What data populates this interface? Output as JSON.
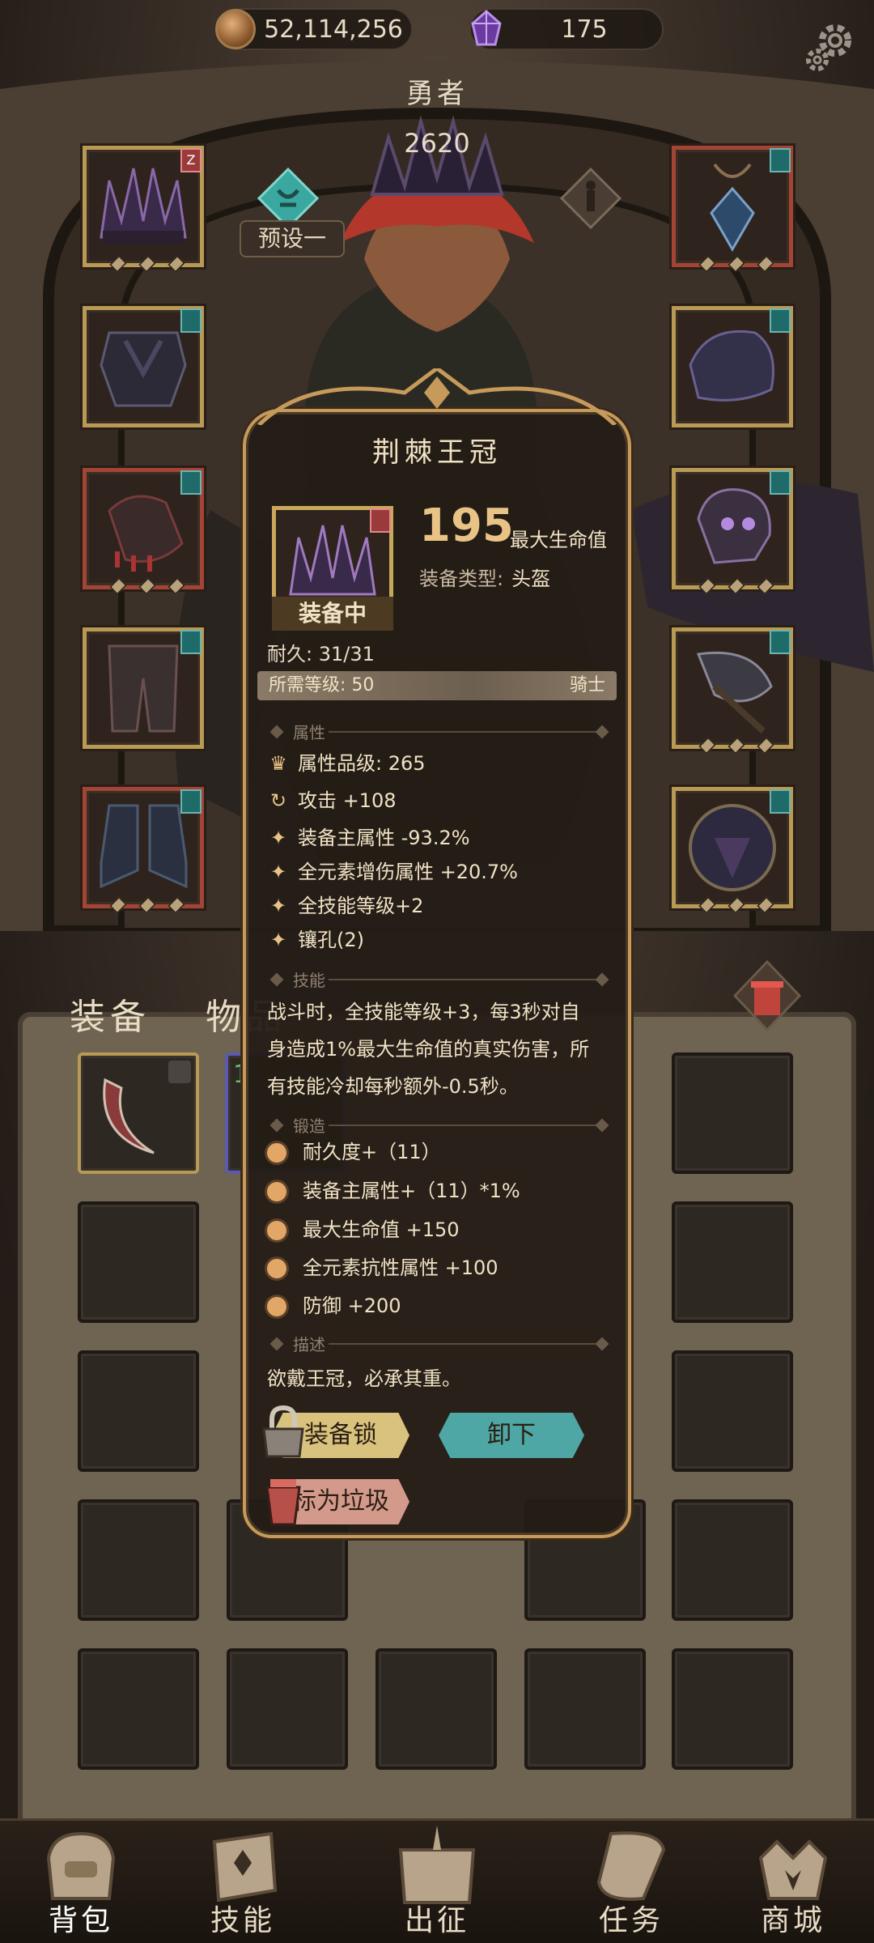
{
  "top": {
    "gold": "52,114,256",
    "gems": "175",
    "gold_icon": "gold-coin-icon",
    "gem_icon": "purple-crystal-icon",
    "settings_icon": "gear-icon"
  },
  "hero": {
    "name": "勇者",
    "power": "2620",
    "preset_label": "预设一"
  },
  "slot_badges": {
    "helmet": "Z"
  },
  "tabs": {
    "equipment": "装备",
    "items": "物品"
  },
  "inventory": {
    "first_item_badge": "1"
  },
  "nav": {
    "items": [
      {
        "label": "背包",
        "icon": "bag-icon"
      },
      {
        "label": "技能",
        "icon": "skill-book-icon"
      },
      {
        "label": "出征",
        "icon": "map-scroll-icon"
      },
      {
        "label": "任务",
        "icon": "quest-scroll-icon"
      },
      {
        "label": "商城",
        "icon": "shop-crown-icon"
      }
    ]
  },
  "popup": {
    "title": "荆棘王冠",
    "equipped_label": "装备中",
    "main_value": "195",
    "main_stat_label": "最大生命值",
    "type_label": "装备类型:",
    "type_value": "头盔",
    "durability": "耐久:  31/31",
    "required_level": "所需等级:  50",
    "required_class": "骑士",
    "section_attr": "属性",
    "section_skill": "技能",
    "section_forge": "锻造",
    "section_desc": "描述",
    "attributes": [
      {
        "icon": "quality-icon",
        "text": "属性品级:  265"
      },
      {
        "icon": "attack-cycle-icon",
        "text": "攻击 +108"
      },
      {
        "icon": "sparkle-icon",
        "text": "装备主属性 -93.2%"
      },
      {
        "icon": "sparkle-icon",
        "text": "全元素增伤属性 +20.7%"
      },
      {
        "icon": "sparkle-icon",
        "text": "全技能等级+2"
      },
      {
        "icon": "sparkle-icon",
        "text": "镶孔(2)"
      }
    ],
    "skill_text_1": "战斗时，全技能等级+3，每3秒对自",
    "skill_text_2": "身造成1%最大生命值的真实伤害，所",
    "skill_text_3": "有技能冷却每秒额外-0.5秒。",
    "forge": [
      "耐久度+（11）",
      "装备主属性+（11）*1%",
      "最大生命值 +150",
      "全元素抗性属性 +100",
      "防御 +200"
    ],
    "description": "欲戴王冠，必承其重。",
    "lock_button": "装备锁",
    "unequip_button": "卸下",
    "trash_button": "标为垃圾"
  }
}
